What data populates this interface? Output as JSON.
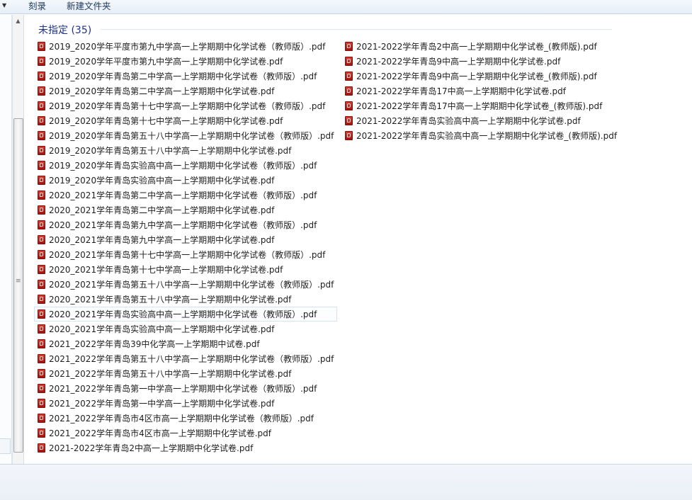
{
  "toolbar": {
    "burn_label": "刻录",
    "new_folder_label": "新建文件夹"
  },
  "group": {
    "title": "未指定 (35)"
  },
  "files_col1": [
    "2019_2020学年平度市第九中学高一上学期期中化学试卷（教师版）.pdf",
    "2019_2020学年平度市第九中学高一上学期期中化学试卷.pdf",
    "2019_2020学年青岛第二中学高一上学期期中化学试卷（教师版）.pdf",
    "2019_2020学年青岛第二中学高一上学期期中化学试卷.pdf",
    "2019_2020学年青岛第十七中学高一上学期期中化学试卷（教师版）.pdf",
    "2019_2020学年青岛第十七中学高一上学期期中化学试卷.pdf",
    "2019_2020学年青岛第五十八中学高一上学期期中化学试卷（教师版）.pdf",
    "2019_2020学年青岛第五十八中学高一上学期期中化学试卷.pdf",
    "2019_2020学年青岛实验高中高一上学期期中化学试卷（教师版）.pdf",
    "2019_2020学年青岛实验高中高一上学期期中化学试卷.pdf",
    "2020_2021学年青岛第二中学高一上学期期中化学试卷（教师版）.pdf",
    "2020_2021学年青岛第二中学高一上学期期中化学试卷.pdf",
    "2020_2021学年青岛第九中学高一上学期期中化学试卷（教师版）.pdf",
    "2020_2021学年青岛第九中学高一上学期期中化学试卷.pdf",
    "2020_2021学年青岛第十七中学高一上学期期中化学试卷（教师版）.pdf",
    "2020_2021学年青岛第十七中学高一上学期期中化学试卷.pdf",
    "2020_2021学年青岛第五十八中学高一上学期期中化学试卷（教师版）.pdf",
    "2020_2021学年青岛第五十八中学高一上学期期中化学试卷.pdf",
    "2020_2021学年青岛实验高中高一上学期期中化学试卷（教师版）.pdf",
    "2020_2021学年青岛实验高中高一上学期期中化学试卷.pdf",
    "2021_2022学年青岛39中化学高一上学期期中试卷.pdf",
    "2021_2022学年青岛第五十八中学高一上学期期中化学试卷（教师版）.pdf",
    "2021_2022学年青岛第五十八中学高一上学期期中化学试卷.pdf",
    "2021_2022学年青岛第一中学高一上学期期中化学试卷（教师版）.pdf",
    "2021_2022学年青岛第一中学高一上学期期中化学试卷.pdf",
    "2021_2022学年青岛市4区市高一上学期期中化学试卷（教师版）.pdf",
    "2021_2022学年青岛市4区市高一上学期期中化学试卷.pdf",
    "2021-2022学年青岛2中高一上学期期中化学试卷.pdf"
  ],
  "files_col2": [
    "2021-2022学年青岛2中高一上学期期中化学试卷_(教师版).pdf",
    "2021-2022学年青岛9中高一上学期期中化学试卷.pdf",
    "2021-2022学年青岛9中高一上学期期中化学试卷_(教师版).pdf",
    "2021-2022学年青岛17中高一上学期期中化学试卷.pdf",
    "2021-2022学年青岛17中高一上学期期中化学试卷_(教师版).pdf",
    "2021-2022学年青岛实验高中高一上学期期中化学试卷.pdf",
    "2021-2022学年青岛实验高中高一上学期期中化学试卷_(教师版).pdf"
  ],
  "icons": {
    "file": "pdf-file-icon",
    "dropdown": "chevron-down-icon"
  },
  "colors": {
    "group_header": "#1e3287",
    "pdf_icon": "#c8281e"
  }
}
